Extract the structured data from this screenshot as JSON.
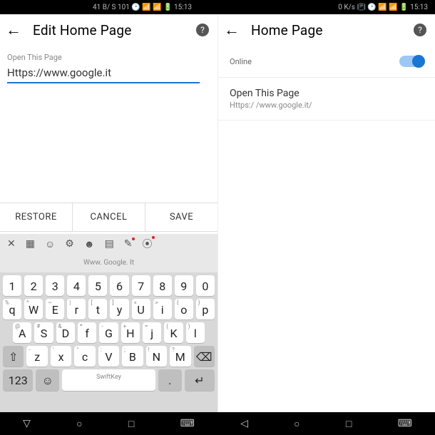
{
  "status": {
    "left": "41 B/ S 101 🕑 📶 📶 🔋 15:13",
    "right": "0 K/s 📳 🕑 📶 📶 🔋 15:13"
  },
  "left": {
    "title": "Edit Home Page",
    "field_label": "Open This Page",
    "url": "Https://www.google.it",
    "buttons": {
      "restore": "RESTORE",
      "cancel": "CANCEL",
      "save": "SAVE"
    },
    "keyboard": {
      "suggestion": "Www. Google. It",
      "row1": [
        "1",
        "2",
        "3",
        "4",
        "5",
        "6",
        "7",
        "8",
        "9",
        "0"
      ],
      "row2": [
        [
          "%",
          "q"
        ],
        [
          "^",
          "W"
        ],
        [
          "~",
          "E"
        ],
        [
          "|",
          "r"
        ],
        [
          "[",
          "t"
        ],
        [
          "]",
          "y"
        ],
        [
          "<",
          "U"
        ],
        [
          ">",
          "i"
        ],
        [
          "{",
          "o"
        ],
        [
          "}",
          "p"
        ]
      ],
      "row3": [
        [
          "@",
          "A"
        ],
        [
          "#",
          "S"
        ],
        [
          "&",
          "D"
        ],
        [
          "*",
          "f"
        ],
        [
          "-",
          "G"
        ],
        [
          "+",
          "H"
        ],
        [
          "=",
          "j"
        ],
        [
          "(",
          "K"
        ],
        [
          ")",
          "l"
        ]
      ],
      "row4": [
        [
          "⇧",
          ""
        ],
        [
          "-",
          "z"
        ],
        [
          "'",
          "x"
        ],
        [
          "\"",
          "c"
        ],
        [
          ":",
          "V"
        ],
        [
          ";",
          "B"
        ],
        [
          "!",
          "N"
        ],
        [
          "?",
          "M"
        ],
        [
          "⌫",
          ""
        ]
      ],
      "row5": {
        "num": "123",
        "emoji": "☺",
        "space": "SwiftKey",
        "dot": ".",
        "enter": "↵"
      }
    }
  },
  "right": {
    "title": "Home Page",
    "toggle_label": "Online",
    "open_title": "Open This Page",
    "open_url": "Https:/ /www.google.it/"
  }
}
